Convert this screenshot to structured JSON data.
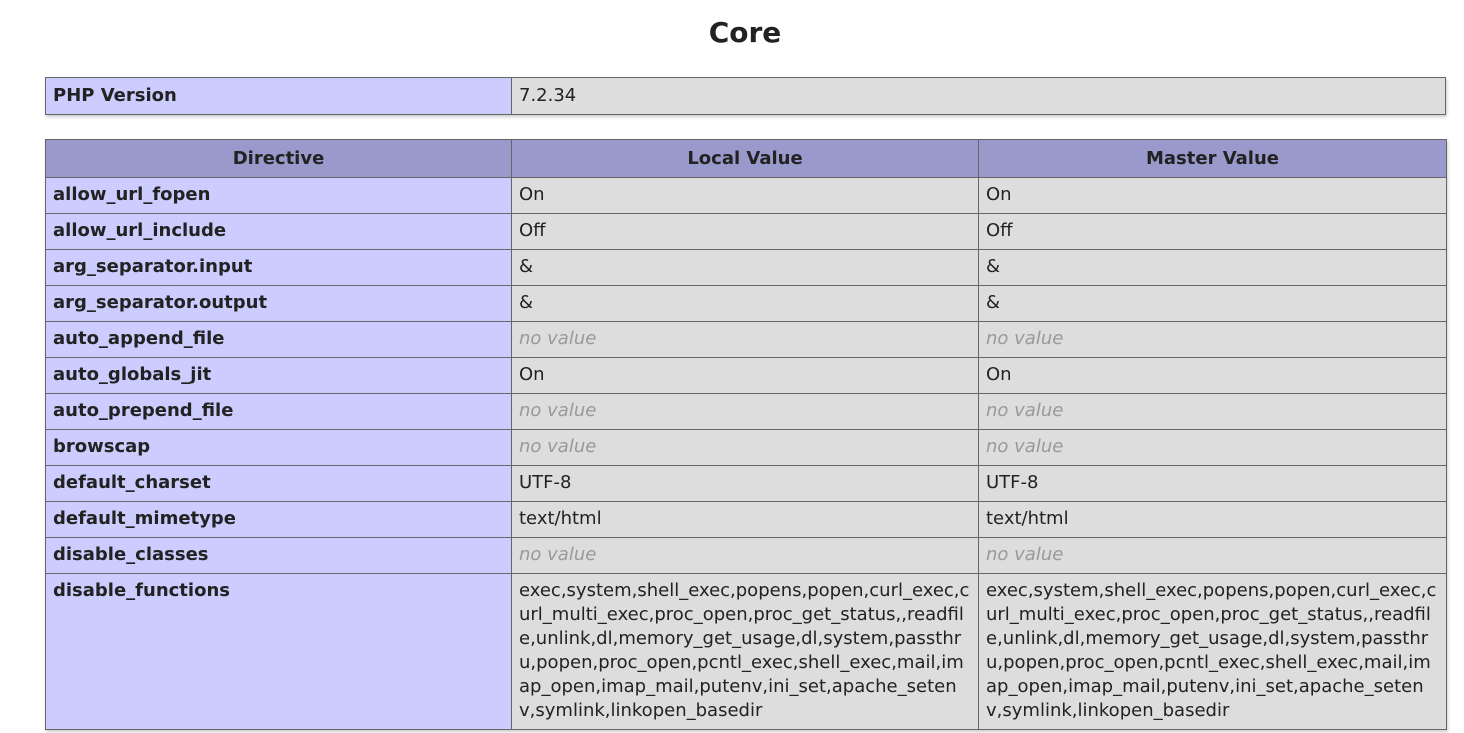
{
  "section": {
    "title": "Core"
  },
  "version": {
    "label": "PHP Version",
    "value": "7.2.34"
  },
  "table": {
    "headers": [
      "Directive",
      "Local Value",
      "Master Value"
    ],
    "rows": [
      {
        "directive": "allow_url_fopen",
        "local": "On",
        "master": "On",
        "no_value": false
      },
      {
        "directive": "allow_url_include",
        "local": "Off",
        "master": "Off",
        "no_value": false
      },
      {
        "directive": "arg_separator.input",
        "local": "&",
        "master": "&",
        "no_value": false
      },
      {
        "directive": "arg_separator.output",
        "local": "&",
        "master": "&",
        "no_value": false
      },
      {
        "directive": "auto_append_file",
        "local": "no value",
        "master": "no value",
        "no_value": true
      },
      {
        "directive": "auto_globals_jit",
        "local": "On",
        "master": "On",
        "no_value": false
      },
      {
        "directive": "auto_prepend_file",
        "local": "no value",
        "master": "no value",
        "no_value": true
      },
      {
        "directive": "browscap",
        "local": "no value",
        "master": "no value",
        "no_value": true
      },
      {
        "directive": "default_charset",
        "local": "UTF-8",
        "master": "UTF-8",
        "no_value": false
      },
      {
        "directive": "default_mimetype",
        "local": "text/html",
        "master": "text/html",
        "no_value": false
      },
      {
        "directive": "disable_classes",
        "local": "no value",
        "master": "no value",
        "no_value": true
      },
      {
        "directive": "disable_functions",
        "local": "exec,system,shell_exec,popens,popen,curl_exec,curl_multi_exec,proc_open,proc_get_status,,readfile,unlink,dl,memory_get_usage,dl,system,passthru,popen,proc_open,pcntl_exec,shell_exec,mail,imap_open,imap_mail,putenv,ini_set,apache_setenv,symlink,linkopen_basedir",
        "master": "exec,system,shell_exec,popens,popen,curl_exec,curl_multi_exec,proc_open,proc_get_status,,readfile,unlink,dl,memory_get_usage,dl,system,passthru,popen,proc_open,pcntl_exec,shell_exec,mail,imap_open,imap_mail,putenv,ini_set,apache_setenv,symlink,linkopen_basedir",
        "no_value": false
      }
    ]
  },
  "colors": {
    "header_bg": "#9999cc",
    "key_bg": "#ccccff",
    "value_bg": "#dddddd",
    "no_value_text": "#999999"
  }
}
